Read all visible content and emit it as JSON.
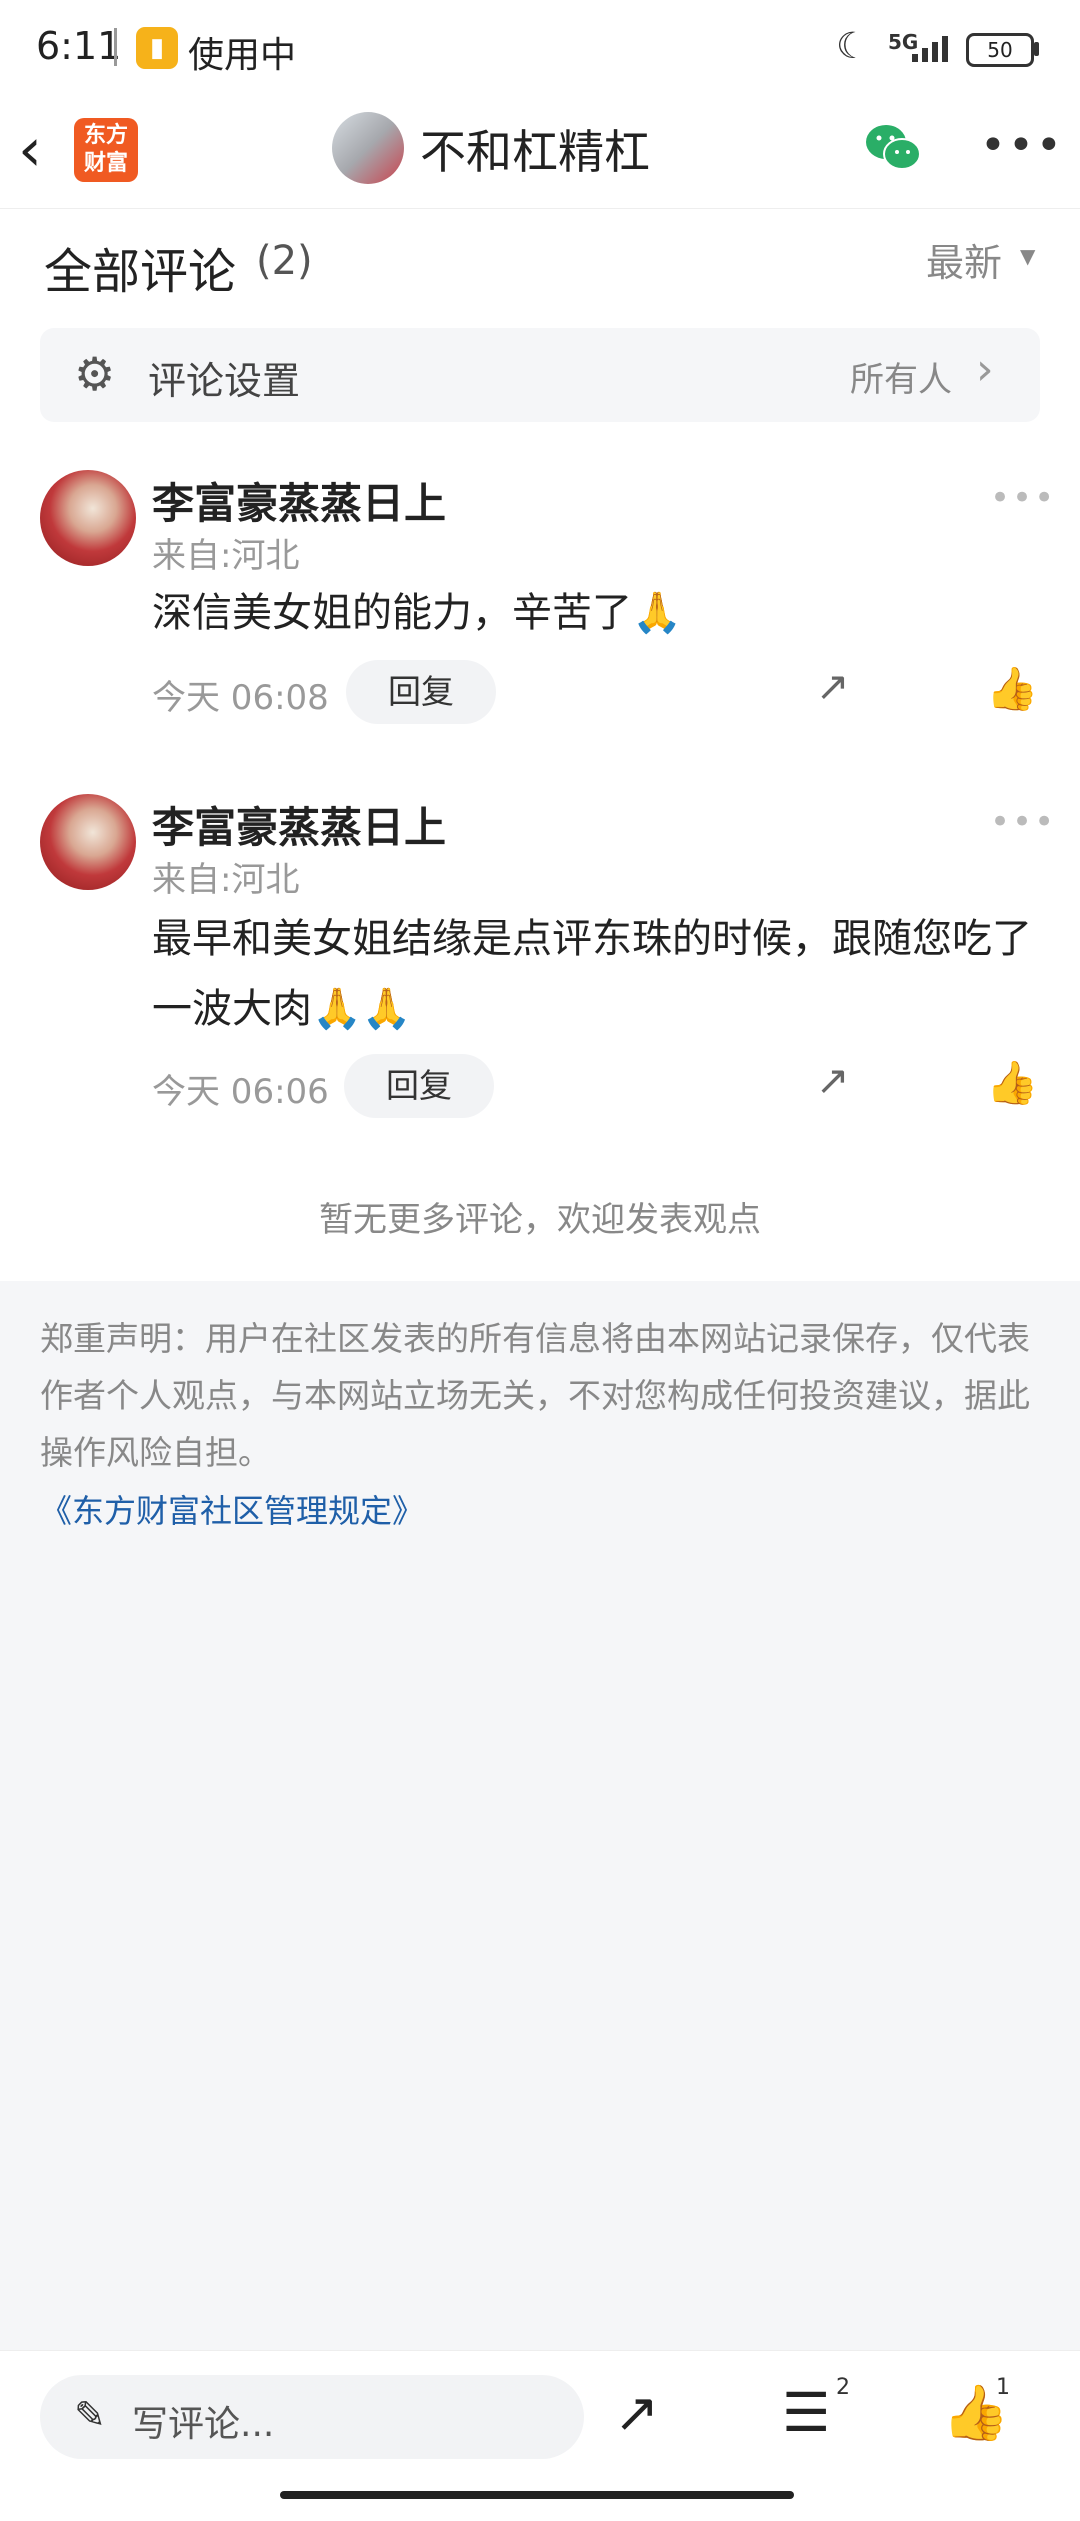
{
  "status_bar": {
    "time": "6:11",
    "app_in_use": "使用中",
    "network": "5G",
    "battery": "50"
  },
  "nav": {
    "logo_line1": "东方",
    "logo_line2": "财富",
    "title": "不和杠精杠"
  },
  "comments_header": {
    "title": "全部评论",
    "count": "(2)",
    "sort": "最新"
  },
  "settings": {
    "label": "评论设置",
    "value": "所有人"
  },
  "comments": [
    {
      "user": "李富豪蒸蒸日上",
      "location": "来自:河北",
      "text": "深信美女姐的能力，辛苦了🙏",
      "time": "今天 06:08",
      "reply_label": "回复"
    },
    {
      "user": "李富豪蒸蒸日上",
      "location": "来自:河北",
      "text": "最早和美女姐结缘是点评东珠的时候，跟随您吃了一波大肉🙏🙏",
      "time": "今天 06:06",
      "reply_label": "回复"
    }
  ],
  "no_more_text": "暂无更多评论，欢迎发表观点",
  "disclaimer": "郑重声明：用户在社区发表的所有信息将由本网站记录保存，仅代表作者个人观点，与本网站立场无关，不对您构成任何投资建议，据此操作风险自担。",
  "rules_link": "《东方财富社区管理规定》",
  "bottom_bar": {
    "input_placeholder": "写评论...",
    "comment_count": "2",
    "like_count": "1"
  },
  "colors": {
    "brand": "#f05a22",
    "link": "#1f5fa8",
    "wechat": "#2aae67"
  }
}
